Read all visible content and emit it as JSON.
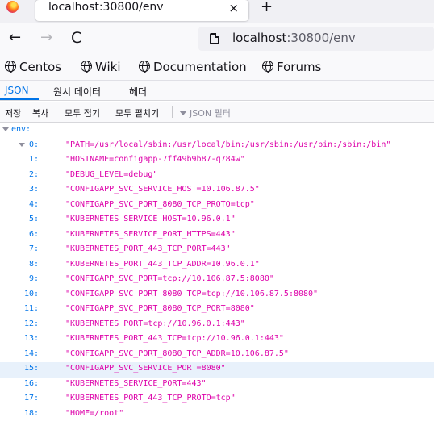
{
  "browser": {
    "tab_title": "localhost:30800/env",
    "close_glyph": "×",
    "new_tab_glyph": "+",
    "back_glyph": "←",
    "forward_glyph": "→",
    "reload_glyph": "C",
    "url_host": "localhost",
    "url_rest": ":30800/env"
  },
  "bookmarks": [
    "Centos",
    "Wiki",
    "Documentation",
    "Forums"
  ],
  "viewer_tabs": [
    "JSON",
    "원시 데이터",
    "헤더"
  ],
  "toolbar": {
    "save": "저장",
    "copy": "복사",
    "collapse_all": "모두 접기",
    "expand_all": "모두 펼치기",
    "filter_placeholder": "JSON 필터"
  },
  "tree": {
    "root_key": "env:",
    "items": [
      {
        "key": "0:",
        "value": "\"PATH=/usr/local/sbin:/usr/local/bin:/usr/sbin:/usr/bin:/sbin:/bin\""
      },
      {
        "key": "1:",
        "value": "\"HOSTNAME=configapp-7ff49b9b87-q784w\""
      },
      {
        "key": "2:",
        "value": "\"DEBUG_LEVEL=debug\""
      },
      {
        "key": "3:",
        "value": "\"CONFIGAPP_SVC_SERVICE_HOST=10.106.87.5\""
      },
      {
        "key": "4:",
        "value": "\"CONFIGAPP_SVC_PORT_8080_TCP_PROTO=tcp\""
      },
      {
        "key": "5:",
        "value": "\"KUBERNETES_SERVICE_HOST=10.96.0.1\""
      },
      {
        "key": "6:",
        "value": "\"KUBERNETES_SERVICE_PORT_HTTPS=443\""
      },
      {
        "key": "7:",
        "value": "\"KUBERNETES_PORT_443_TCP_PORT=443\""
      },
      {
        "key": "8:",
        "value": "\"KUBERNETES_PORT_443_TCP_ADDR=10.96.0.1\""
      },
      {
        "key": "9:",
        "value": "\"CONFIGAPP_SVC_PORT=tcp://10.106.87.5:8080\""
      },
      {
        "key": "10:",
        "value": "\"CONFIGAPP_SVC_PORT_8080_TCP=tcp://10.106.87.5:8080\""
      },
      {
        "key": "11:",
        "value": "\"CONFIGAPP_SVC_PORT_8080_TCP_PORT=8080\""
      },
      {
        "key": "12:",
        "value": "\"KUBERNETES_PORT=tcp://10.96.0.1:443\""
      },
      {
        "key": "13:",
        "value": "\"KUBERNETES_PORT_443_TCP=tcp://10.96.0.1:443\""
      },
      {
        "key": "14:",
        "value": "\"CONFIGAPP_SVC_PORT_8080_TCP_ADDR=10.106.87.5\""
      },
      {
        "key": "15:",
        "value": "\"CONFIGAPP_SVC_SERVICE_PORT=8080\""
      },
      {
        "key": "16:",
        "value": "\"KUBERNETES_SERVICE_PORT=443\""
      },
      {
        "key": "17:",
        "value": "\"KUBERNETES_PORT_443_TCP_PROTO=tcp\""
      },
      {
        "key": "18:",
        "value": "\"HOME=/root\""
      }
    ],
    "highlighted_index": 15
  }
}
